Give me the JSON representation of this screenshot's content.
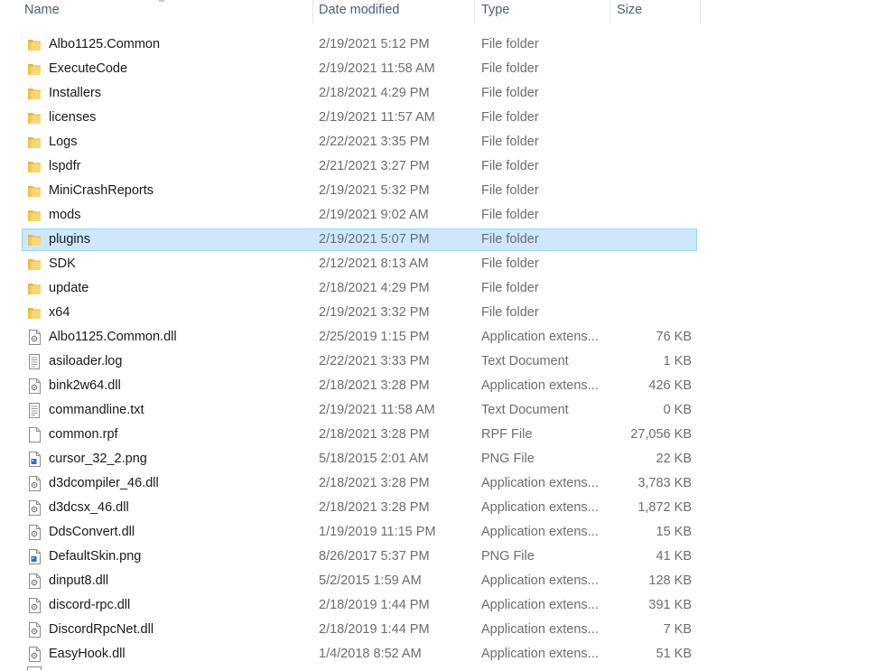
{
  "columns": {
    "name": "Name",
    "date": "Date modified",
    "type": "Type",
    "size": "Size"
  },
  "colors": {
    "selected_bg": "#cce8ff",
    "selected_border": "#99d1ff",
    "folder": "#f3c34a",
    "header_text": "#4c607a",
    "secondary_text": "#6d6d6d"
  },
  "rows": [
    {
      "name": "Albo1125.Common",
      "date": "2/19/2021 5:12 PM",
      "type": "File folder",
      "size": "",
      "icon": "folder-icon",
      "selected": false
    },
    {
      "name": "ExecuteCode",
      "date": "2/19/2021 11:58 AM",
      "type": "File folder",
      "size": "",
      "icon": "folder-icon",
      "selected": false
    },
    {
      "name": "Installers",
      "date": "2/18/2021 4:29 PM",
      "type": "File folder",
      "size": "",
      "icon": "folder-icon",
      "selected": false
    },
    {
      "name": "licenses",
      "date": "2/19/2021 11:57 AM",
      "type": "File folder",
      "size": "",
      "icon": "folder-icon",
      "selected": false
    },
    {
      "name": "Logs",
      "date": "2/22/2021 3:35 PM",
      "type": "File folder",
      "size": "",
      "icon": "folder-icon",
      "selected": false
    },
    {
      "name": "lspdfr",
      "date": "2/21/2021 3:27 PM",
      "type": "File folder",
      "size": "",
      "icon": "folder-icon",
      "selected": false
    },
    {
      "name": "MiniCrashReports",
      "date": "2/19/2021 5:32 PM",
      "type": "File folder",
      "size": "",
      "icon": "folder-icon",
      "selected": false
    },
    {
      "name": "mods",
      "date": "2/19/2021 9:02 AM",
      "type": "File folder",
      "size": "",
      "icon": "folder-icon",
      "selected": false
    },
    {
      "name": "plugins",
      "date": "2/19/2021 5:07 PM",
      "type": "File folder",
      "size": "",
      "icon": "folder-icon",
      "selected": true
    },
    {
      "name": "SDK",
      "date": "2/12/2021 8:13 AM",
      "type": "File folder",
      "size": "",
      "icon": "folder-icon",
      "selected": false
    },
    {
      "name": "update",
      "date": "2/18/2021 4:29 PM",
      "type": "File folder",
      "size": "",
      "icon": "folder-icon",
      "selected": false
    },
    {
      "name": "x64",
      "date": "2/19/2021 3:32 PM",
      "type": "File folder",
      "size": "",
      "icon": "folder-icon",
      "selected": false
    },
    {
      "name": "Albo1125.Common.dll",
      "date": "2/25/2019 1:15 PM",
      "type": "Application extens...",
      "size": "76 KB",
      "icon": "dll-file-icon",
      "selected": false
    },
    {
      "name": "asiloader.log",
      "date": "2/22/2021 3:33 PM",
      "type": "Text Document",
      "size": "1 KB",
      "icon": "text-file-icon",
      "selected": false
    },
    {
      "name": "bink2w64.dll",
      "date": "2/18/2021 3:28 PM",
      "type": "Application extens...",
      "size": "426 KB",
      "icon": "dll-file-icon",
      "selected": false
    },
    {
      "name": "commandline.txt",
      "date": "2/19/2021 11:58 AM",
      "type": "Text Document",
      "size": "0 KB",
      "icon": "text-file-icon",
      "selected": false
    },
    {
      "name": "common.rpf",
      "date": "2/18/2021 3:28 PM",
      "type": "RPF File",
      "size": "27,056 KB",
      "icon": "blank-file-icon",
      "selected": false
    },
    {
      "name": "cursor_32_2.png",
      "date": "5/18/2015 2:01 AM",
      "type": "PNG File",
      "size": "22 KB",
      "icon": "image-file-icon",
      "selected": false
    },
    {
      "name": "d3dcompiler_46.dll",
      "date": "2/18/2021 3:28 PM",
      "type": "Application extens...",
      "size": "3,783 KB",
      "icon": "dll-file-icon",
      "selected": false
    },
    {
      "name": "d3dcsx_46.dll",
      "date": "2/18/2021 3:28 PM",
      "type": "Application extens...",
      "size": "1,872 KB",
      "icon": "dll-file-icon",
      "selected": false
    },
    {
      "name": "DdsConvert.dll",
      "date": "1/19/2019 11:15 PM",
      "type": "Application extens...",
      "size": "15 KB",
      "icon": "dll-file-icon",
      "selected": false
    },
    {
      "name": "DefaultSkin.png",
      "date": "8/26/2017 5:37 PM",
      "type": "PNG File",
      "size": "41 KB",
      "icon": "image-file-icon",
      "selected": false
    },
    {
      "name": "dinput8.dll",
      "date": "5/2/2015 1:59 AM",
      "type": "Application extens...",
      "size": "128 KB",
      "icon": "dll-file-icon",
      "selected": false
    },
    {
      "name": "discord-rpc.dll",
      "date": "2/18/2019 1:44 PM",
      "type": "Application extens...",
      "size": "391 KB",
      "icon": "dll-file-icon",
      "selected": false
    },
    {
      "name": "DiscordRpcNet.dll",
      "date": "2/18/2019 1:44 PM",
      "type": "Application extens...",
      "size": "7 KB",
      "icon": "dll-file-icon",
      "selected": false
    },
    {
      "name": "EasyHook.dll",
      "date": "1/4/2018 8:52 AM",
      "type": "Application extens...",
      "size": "51 KB",
      "icon": "dll-file-icon",
      "selected": false
    }
  ]
}
